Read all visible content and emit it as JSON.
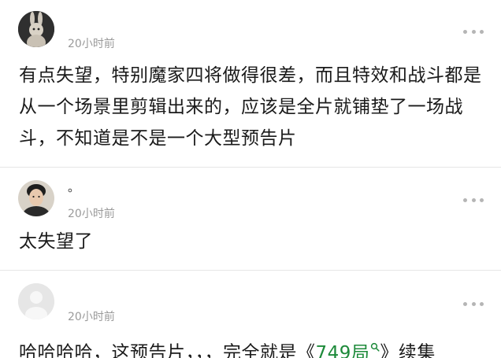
{
  "comments": [
    {
      "username": "",
      "time": "20小时前",
      "text": "有点失望，特别魔家四将做得很差，而且特效和战斗都是从一个场景里剪辑出来的，应该是全片就铺垫了一场战斗，不知道是不是一个大型预告片",
      "avatar_icon": "rabbit-avatar-icon"
    },
    {
      "username": "。",
      "time": "20小时前",
      "text": "太失望了",
      "avatar_icon": "person-avatar-icon"
    },
    {
      "username": "",
      "time": "20小时前",
      "text_before": "哈哈哈哈，这预告片，，，完全就是《",
      "link_text": "749局",
      "text_after": "》续集",
      "avatar_icon": "default-avatar-icon"
    }
  ],
  "colors": {
    "link": "#1d8a3a",
    "time": "#9a9a9a",
    "divider": "#e6e6e6"
  },
  "icons": {
    "more": "more-options-icon",
    "search": "search-icon"
  }
}
